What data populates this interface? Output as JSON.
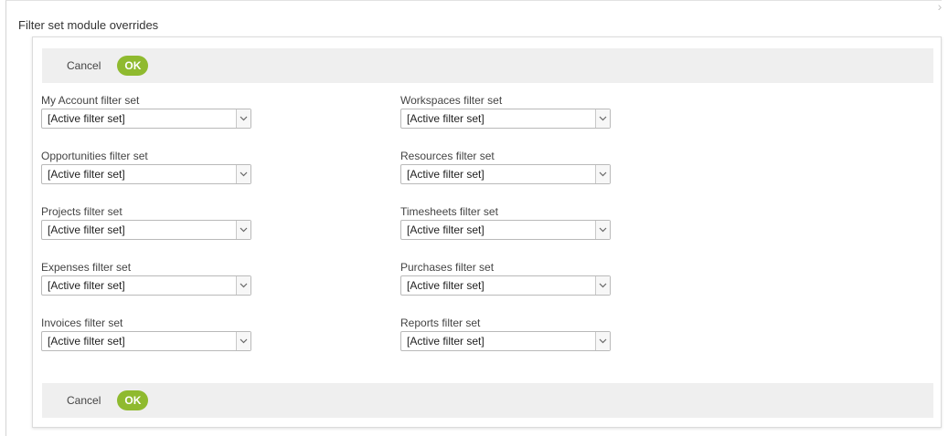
{
  "dialog": {
    "title": "Filter set module overrides",
    "close_glyph": "›"
  },
  "actions_top": {
    "cancel_label": "Cancel",
    "ok_label": "OK"
  },
  "actions_bottom": {
    "cancel_label": "Cancel",
    "ok_label": "OK"
  },
  "colors": {
    "ok_button": "#8fba2f",
    "action_bar": "#efefef"
  },
  "fields": [
    {
      "label": "My Account filter set",
      "value": "[Active filter set]"
    },
    {
      "label": "Workspaces filter set",
      "value": "[Active filter set]"
    },
    {
      "label": "Opportunities filter set",
      "value": "[Active filter set]"
    },
    {
      "label": "Resources filter set",
      "value": "[Active filter set]"
    },
    {
      "label": "Projects filter set",
      "value": "[Active filter set]"
    },
    {
      "label": "Timesheets filter set",
      "value": "[Active filter set]"
    },
    {
      "label": "Expenses filter set",
      "value": "[Active filter set]"
    },
    {
      "label": "Purchases filter set",
      "value": "[Active filter set]"
    },
    {
      "label": "Invoices filter set",
      "value": "[Active filter set]"
    },
    {
      "label": "Reports filter set",
      "value": "[Active filter set]"
    }
  ]
}
